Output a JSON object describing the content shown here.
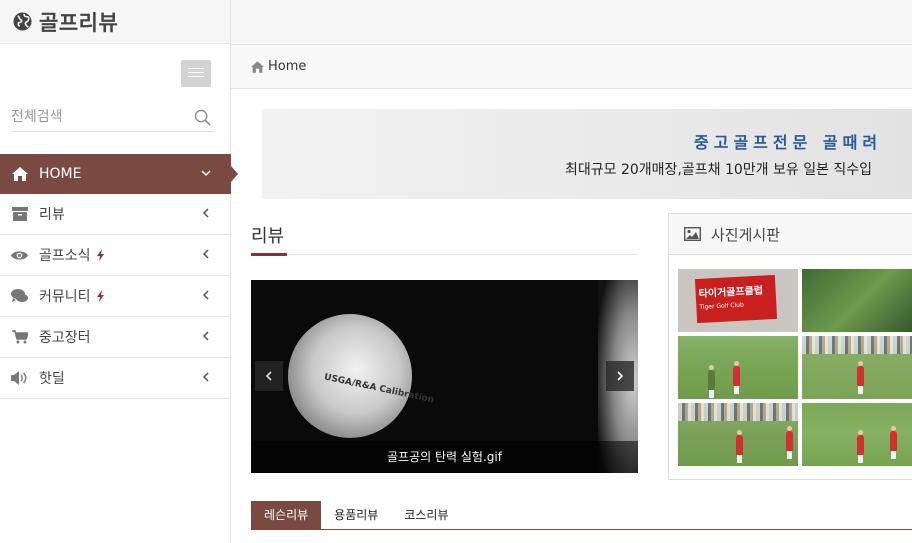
{
  "brand": {
    "title": "골프리뷰",
    "icon": "globe-icon"
  },
  "sidebar": {
    "toggle_icon": "menu-toggle-icon",
    "search": {
      "placeholder": "전체검색",
      "icon": "search-icon"
    },
    "items": [
      {
        "label": "HOME",
        "icon": "home-icon",
        "active": true,
        "new": false,
        "chevron": "chevron-down-icon"
      },
      {
        "label": "리뷰",
        "icon": "archive-icon",
        "active": false,
        "new": false,
        "chevron": "chevron-left-icon"
      },
      {
        "label": "골프소식",
        "icon": "eye-icon",
        "active": false,
        "new": true,
        "chevron": "chevron-left-icon"
      },
      {
        "label": "커뮤니티",
        "icon": "comments-icon",
        "active": false,
        "new": true,
        "chevron": "chevron-left-icon"
      },
      {
        "label": "중고장터",
        "icon": "cart-icon",
        "active": false,
        "new": false,
        "chevron": "chevron-left-icon"
      },
      {
        "label": "핫딜",
        "icon": "volume-icon",
        "active": false,
        "new": false,
        "chevron": "chevron-left-icon"
      }
    ]
  },
  "breadcrumb": {
    "label": "Home"
  },
  "banner": {
    "line1": "중고골프전문 골때려",
    "line2": "최대규모 20개매장,골프채 10만개 보유 일본 직수입"
  },
  "review": {
    "title": "리뷰",
    "slide_caption": "골프공의 탄력 실험.gif",
    "ball_print": "USGA/R&A Calibration"
  },
  "tabs": [
    {
      "label": "레슨리뷰",
      "active": true
    },
    {
      "label": "용품리뷰",
      "active": false
    },
    {
      "label": "코스리뷰",
      "active": false
    }
  ],
  "photo_board": {
    "title": "사진게시판",
    "sign_text": "타이거골프클럽",
    "sign_sub": "Tiger Golf Club"
  },
  "colors": {
    "accent": "#7a4a42",
    "underline": "#8b2f3e",
    "banner_text": "#2a5a9a"
  }
}
